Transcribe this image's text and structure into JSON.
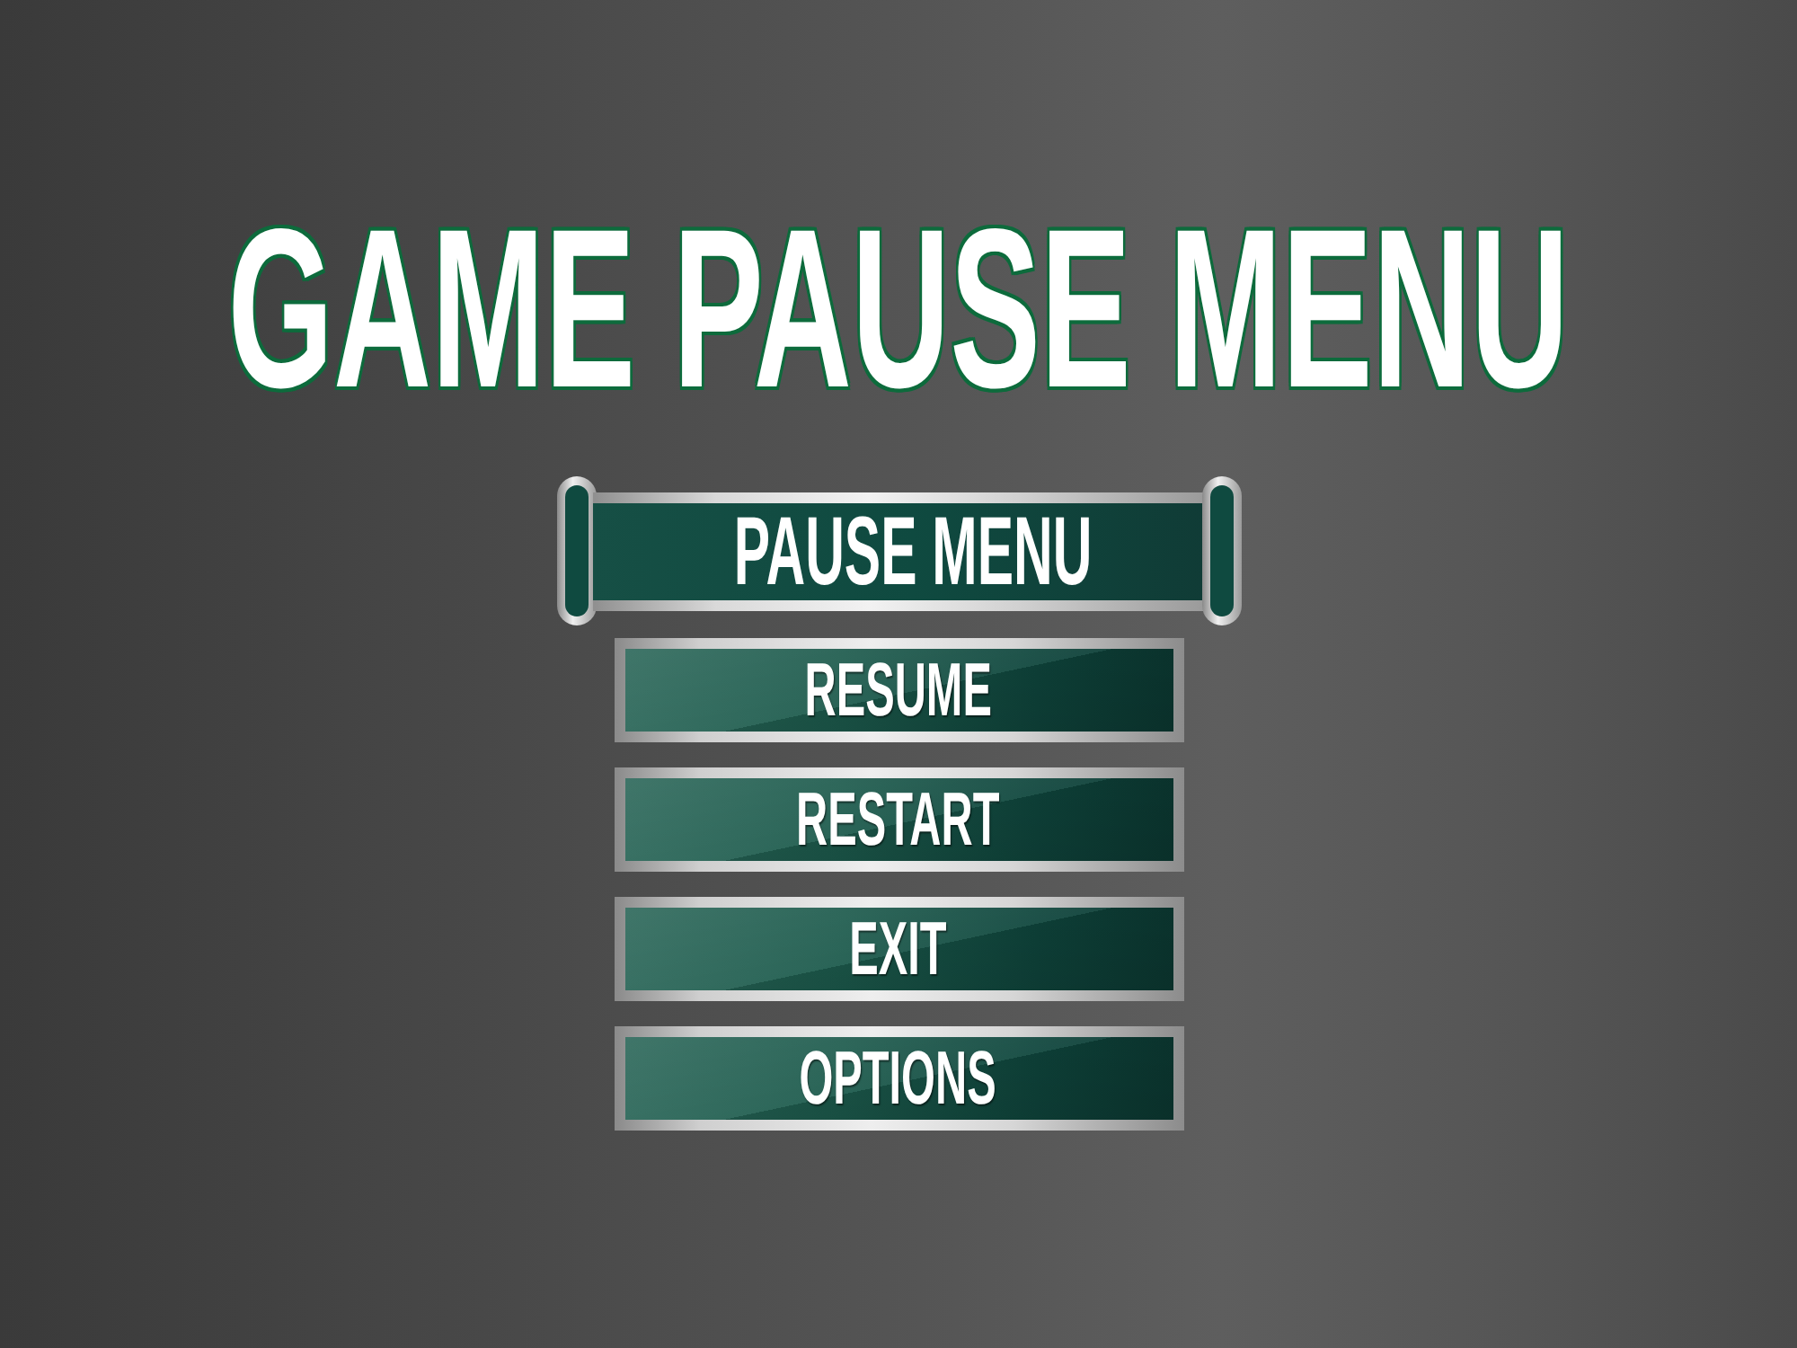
{
  "title": "GAME PAUSE MENU",
  "header": {
    "label": "PAUSE MENU"
  },
  "buttons": [
    {
      "label": "RESUME"
    },
    {
      "label": "RESTART"
    },
    {
      "label": "EXIT"
    },
    {
      "label": "OPTIONS"
    }
  ]
}
